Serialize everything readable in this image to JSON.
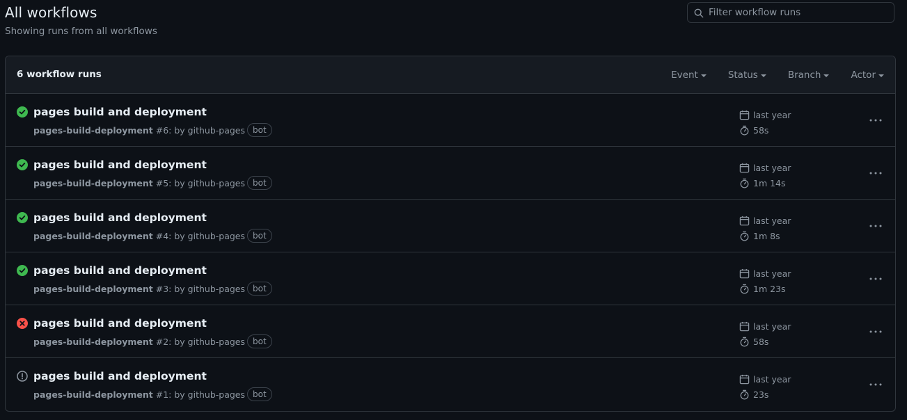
{
  "header": {
    "title": "All workflows",
    "subtitle": "Showing runs from all workflows"
  },
  "search": {
    "placeholder": "Filter workflow runs"
  },
  "runs_panel": {
    "count_label": "6 workflow runs",
    "filters": [
      "Event",
      "Status",
      "Branch",
      "Actor"
    ]
  },
  "colors": {
    "success": "#3fb950",
    "failure": "#f85149",
    "neutral": "#8d96a0"
  },
  "runs": [
    {
      "status": "success",
      "status_icon": "check-circle-icon",
      "title": "pages build and deployment",
      "workflow": "pages-build-deployment",
      "run_suffix": "#6: by github-pages",
      "badge": "bot",
      "when": "last year",
      "duration": "58s"
    },
    {
      "status": "success",
      "status_icon": "check-circle-icon",
      "title": "pages build and deployment",
      "workflow": "pages-build-deployment",
      "run_suffix": "#5: by github-pages",
      "badge": "bot",
      "when": "last year",
      "duration": "1m 14s"
    },
    {
      "status": "success",
      "status_icon": "check-circle-icon",
      "title": "pages build and deployment",
      "workflow": "pages-build-deployment",
      "run_suffix": "#4: by github-pages",
      "badge": "bot",
      "when": "last year",
      "duration": "1m 8s"
    },
    {
      "status": "success",
      "status_icon": "check-circle-icon",
      "title": "pages build and deployment",
      "workflow": "pages-build-deployment",
      "run_suffix": "#3: by github-pages",
      "badge": "bot",
      "when": "last year",
      "duration": "1m 23s"
    },
    {
      "status": "failure",
      "status_icon": "x-circle-icon",
      "title": "pages build and deployment",
      "workflow": "pages-build-deployment",
      "run_suffix": "#2: by github-pages",
      "badge": "bot",
      "when": "last year",
      "duration": "58s"
    },
    {
      "status": "cancelled",
      "status_icon": "alert-circle-icon",
      "title": "pages build and deployment",
      "workflow": "pages-build-deployment",
      "run_suffix": "#1: by github-pages",
      "badge": "bot",
      "when": "last year",
      "duration": "23s"
    }
  ]
}
